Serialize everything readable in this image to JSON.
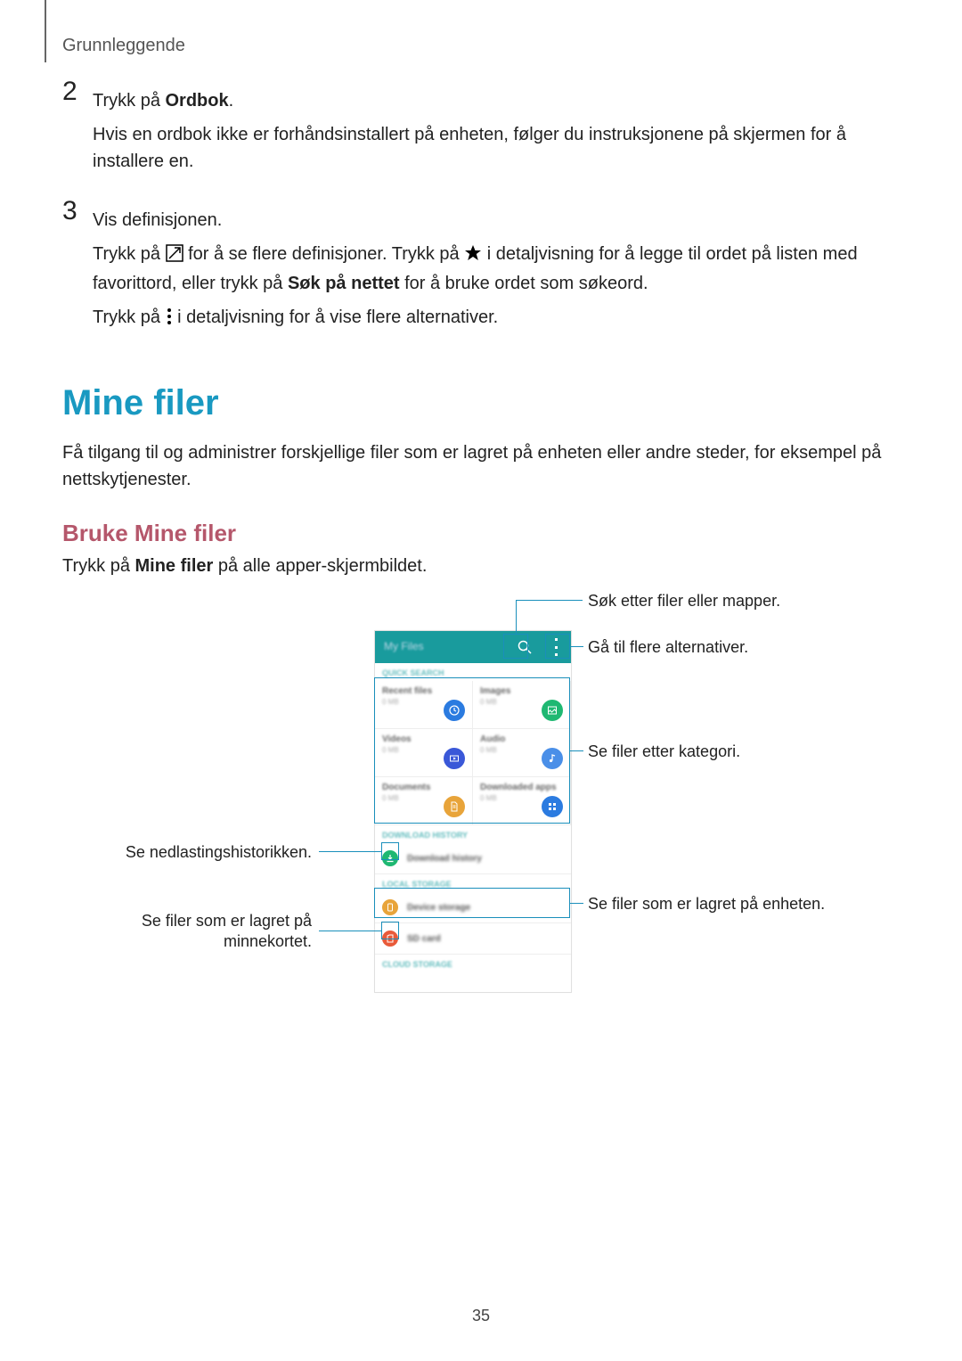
{
  "breadcrumb": "Grunnleggende",
  "step2": {
    "num": "2",
    "line1a": "Trykk på ",
    "line1b": "Ordbok",
    "line1c": ".",
    "line2": "Hvis en ordbok ikke er forhåndsinstallert på enheten, følger du instruksjonene på skjermen for å installere en."
  },
  "step3": {
    "num": "3",
    "line1": "Vis definisjonen.",
    "p2a": "Trykk på ",
    "p2b": " for å se flere definisjoner. Trykk på ",
    "p2c": " i detaljvisning for å legge til ordet på listen med favorittord, eller trykk på ",
    "p2bold": "Søk på nettet",
    "p2d": " for å bruke ordet som søkeord.",
    "p3a": "Trykk på ",
    "p3b": " i detaljvisning for å vise flere alternativer."
  },
  "h1": "Mine filer",
  "intro": "Få tilgang til og administrer forskjellige filer som er lagret på enheten eller andre steder, for eksempel på nettskytjenester.",
  "h2": "Bruke Mine filer",
  "intro2a": "Trykk på ",
  "intro2bold": "Mine filer",
  "intro2b": " på alle apper-skjermbildet.",
  "callouts": {
    "search": "Søk etter filer eller mapper.",
    "more": "Gå til flere alternativer.",
    "category": "Se filer etter kategori.",
    "downloads": "Se nedlastingshistorikken.",
    "deviceRight": "Se filer som er lagret på enheten.",
    "sdcard": "Se filer som er lagret på minnekortet."
  },
  "phone": {
    "title": "My Files",
    "sec_quick": "QUICK SEARCH",
    "cat1": "Recent files",
    "cat2": "Images",
    "cat3": "Videos",
    "cat4": "Audio",
    "cat5": "Documents",
    "cat6": "Downloaded apps",
    "sub": "0 MB",
    "sec_dlh": "DOWNLOAD HISTORY",
    "row_dl": "Download history",
    "sec_local": "LOCAL STORAGE",
    "row_dev": "Device storage",
    "row_sd": "SD card",
    "sec_cloud": "CLOUD STORAGE"
  },
  "pageNumber": "35"
}
